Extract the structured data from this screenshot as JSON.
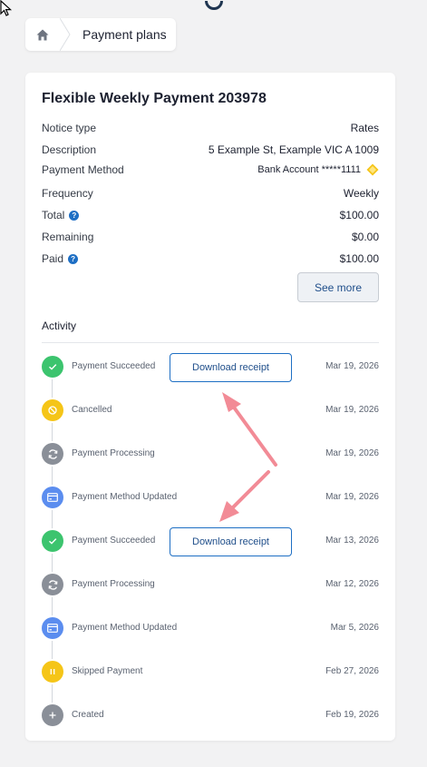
{
  "breadcrumb": {
    "home_icon": "home-icon",
    "current": "Payment plans"
  },
  "plan": {
    "title": "Flexible Weekly Payment 203978",
    "details": [
      {
        "label": "Notice type",
        "value": "Rates",
        "help": false
      },
      {
        "label": "Description",
        "value": "5 Example St, Example VIC A 1009",
        "help": false
      },
      {
        "label": "Payment Method",
        "value": "Bank Account *****1111",
        "help": false
      },
      {
        "label": "Frequency",
        "value": "Weekly",
        "help": false
      },
      {
        "label": "Total",
        "value": "$100.00",
        "help": true
      },
      {
        "label": "Remaining",
        "value": "$0.00",
        "help": false
      },
      {
        "label": "Paid",
        "value": "$100.00",
        "help": true
      }
    ],
    "see_more_label": "See more"
  },
  "activity": {
    "title": "Activity",
    "download_label": "Download receipt",
    "items": [
      {
        "status": "Payment Succeeded",
        "date": "Mar 19, 2026",
        "icon": "check-icon",
        "color": "#3cc46e",
        "receipt": true
      },
      {
        "status": "Cancelled",
        "date": "Mar 19, 2026",
        "icon": "cancel-icon",
        "color": "#f5c518",
        "receipt": false
      },
      {
        "status": "Payment Processing",
        "date": "Mar 19, 2026",
        "icon": "refresh-icon",
        "color": "#8a8f98",
        "receipt": false
      },
      {
        "status": "Payment Method Updated",
        "date": "Mar 19, 2026",
        "icon": "card-icon",
        "color": "#5b8def",
        "receipt": false
      },
      {
        "status": "Payment Succeeded",
        "date": "Mar 13, 2026",
        "icon": "check-icon",
        "color": "#3cc46e",
        "receipt": true
      },
      {
        "status": "Payment Processing",
        "date": "Mar 12, 2026",
        "icon": "refresh-icon",
        "color": "#8a8f98",
        "receipt": false
      },
      {
        "status": "Payment Method Updated",
        "date": "Mar 5, 2026",
        "icon": "card-icon",
        "color": "#5b8def",
        "receipt": false
      },
      {
        "status": "Skipped Payment",
        "date": "Feb 27, 2026",
        "icon": "pause-icon",
        "color": "#f5c518",
        "receipt": false
      },
      {
        "status": "Created",
        "date": "Feb 19, 2026",
        "icon": "plus-icon",
        "color": "#8a8f98",
        "receipt": false
      }
    ]
  },
  "annotation_color": "#f28b96",
  "bank_badge_color": "#f5c518"
}
